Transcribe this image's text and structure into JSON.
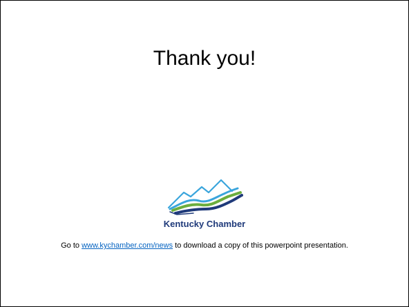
{
  "slide": {
    "title": "Thank you!",
    "logo": {
      "icon": "kentucky-chamber-mountain-logo",
      "name": "Kentucky Chamber",
      "colors": {
        "navy": "#1f3a7a",
        "light_blue": "#3aa5dc",
        "green": "#6cae3e"
      }
    },
    "caption": {
      "prefix": "Go to ",
      "link_text": "www.kychamber.com/news",
      "suffix": " to download a copy of this powerpoint presentation."
    }
  }
}
